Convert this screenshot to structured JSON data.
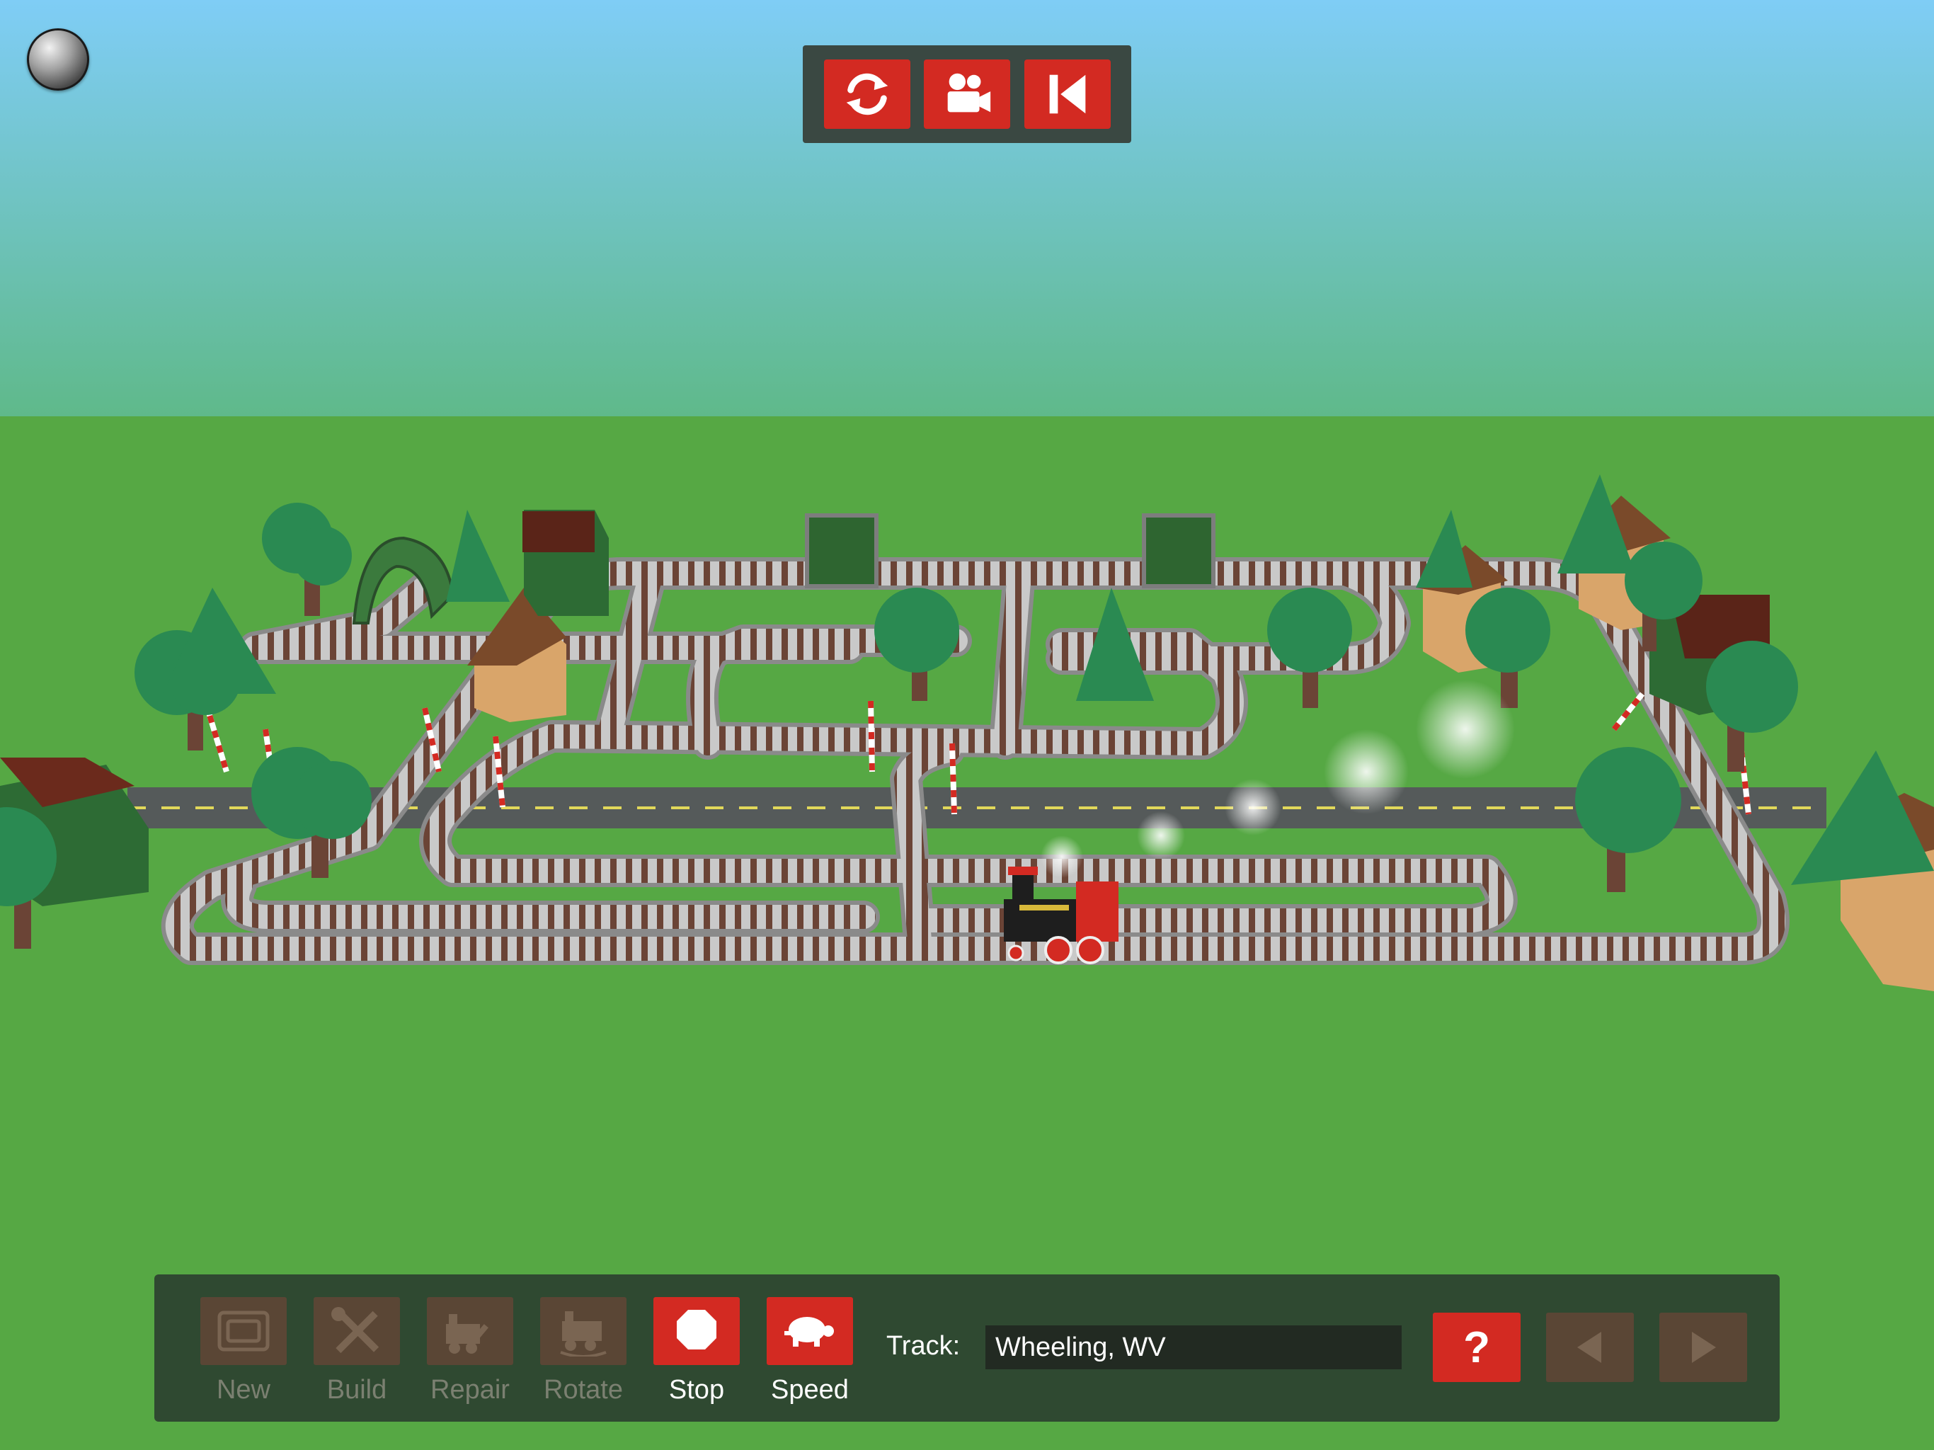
{
  "toolbar_top": {
    "refresh_icon": "refresh-icon",
    "camera_icon": "movie-camera-icon",
    "rewind_icon": "skip-back-icon"
  },
  "tools": [
    {
      "label": "New",
      "icon": "new-track-icon",
      "state": "disabled"
    },
    {
      "label": "Build",
      "icon": "tools-icon",
      "state": "disabled"
    },
    {
      "label": "Repair",
      "icon": "repair-train-icon",
      "state": "disabled"
    },
    {
      "label": "Rotate",
      "icon": "rotate-train-icon",
      "state": "disabled"
    },
    {
      "label": "Stop",
      "icon": "stop-octagon-icon",
      "state": "active"
    },
    {
      "label": "Speed",
      "icon": "turtle-icon",
      "state": "active"
    }
  ],
  "track": {
    "label": "Track:",
    "value": "Wheeling, WV"
  },
  "help": {
    "label": "?"
  },
  "nav": {
    "prev_icon": "left-arrow-icon",
    "next_icon": "right-arrow-icon"
  },
  "colors": {
    "accent_red": "#d32a22",
    "disabled_brown": "#5a4635",
    "bar_green": "#2f4931",
    "grass": "#56a844"
  }
}
